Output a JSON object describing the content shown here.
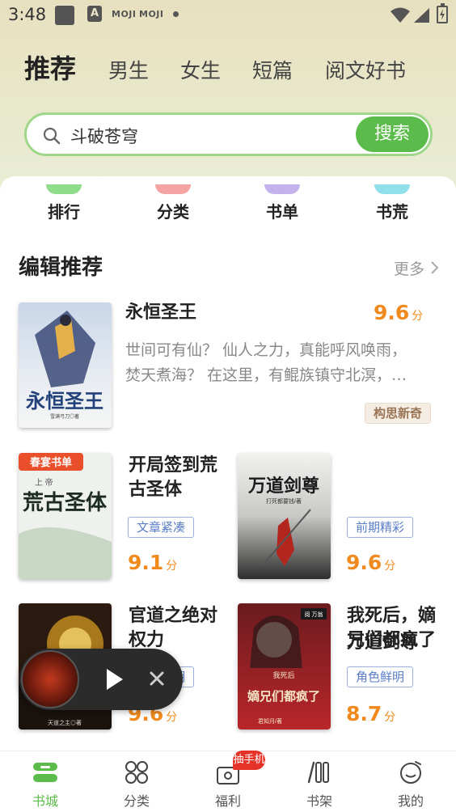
{
  "status_bar": {
    "time": "3:48",
    "icon_a_label": "A",
    "moji_1": "MOJI",
    "moji_2": "MOJI"
  },
  "tabs": [
    {
      "label": "推荐",
      "active": true
    },
    {
      "label": "男生"
    },
    {
      "label": "女生"
    },
    {
      "label": "短篇"
    },
    {
      "label": "阅文好书"
    }
  ],
  "search": {
    "value": "斗破苍穹",
    "button_label": "搜索"
  },
  "quick_links": [
    {
      "label": "排行",
      "color": "#8fdc8a"
    },
    {
      "label": "分类",
      "color": "#f5a3a3"
    },
    {
      "label": "书单",
      "color": "#c3b2ec"
    },
    {
      "label": "书荒",
      "color": "#8fe0ea"
    }
  ],
  "section": {
    "title": "编辑推荐",
    "more_label": "更多"
  },
  "featured": {
    "title": "永恒圣王",
    "score": "9.6",
    "score_unit": "分",
    "desc_line1": "世间可有仙？ 仙人之力，真能呼风唤雨，",
    "desc_line2": "焚天煮海？ 在这里，有鲲族镇守北溟，…",
    "tag": "构思新奇",
    "cover_title": "永恒圣王",
    "cover_author": "雪满弓刀◎著"
  },
  "books": [
    {
      "title": "开局签到荒古圣体",
      "tag": "文章紧凑",
      "score": "9.1",
      "score_unit": "分",
      "cover_ribbon": "春宴书单",
      "cover_title": "荒古圣体",
      "cover_author": "上 帝"
    },
    {
      "title": "万道剑尊",
      "tag": "前期精彩",
      "score": "9.6",
      "score_unit": "分",
      "cover_title": "万道剑尊",
      "cover_author": "打死都要钱/著"
    },
    {
      "title": "官道之绝对权力",
      "tag": "角色鲜明",
      "score": "9.6",
      "score_unit": "分",
      "cover_author": "天道之主◎著"
    },
    {
      "title": "我死后，嫡兄们都疯了",
      "tag": "角色鲜明",
      "score": "8.7",
      "score_unit": "分",
      "cover_ribbon": "我死后",
      "cover_title": "嫡兄们都疯了",
      "cover_author": "君知月/著",
      "cover_badge": "阅 万翁"
    }
  ],
  "bottom_nav": [
    {
      "label": "书城",
      "active": true
    },
    {
      "label": "分类"
    },
    {
      "label": "福利",
      "badge": "抽手机"
    },
    {
      "label": "书架"
    },
    {
      "label": "我的"
    }
  ]
}
